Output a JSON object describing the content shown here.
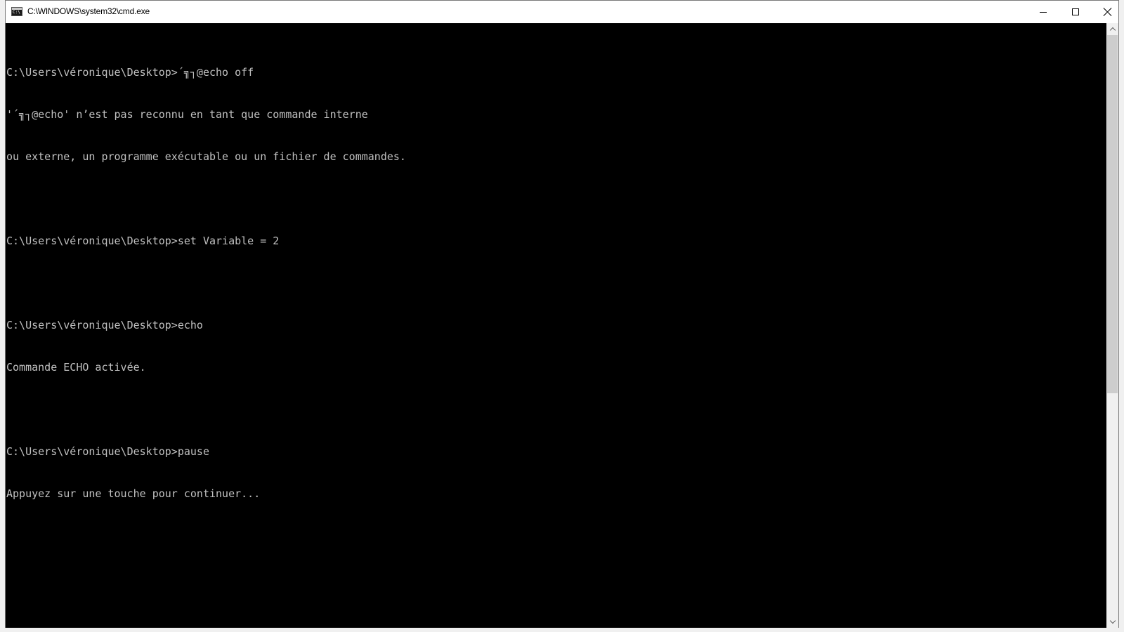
{
  "window": {
    "title": "C:\\WINDOWS\\system32\\cmd.exe",
    "icon": "cmd-icon",
    "controls": {
      "minimize_icon": "minimize-icon",
      "maximize_icon": "maximize-icon",
      "close_icon": "close-icon"
    }
  },
  "console": {
    "background": "#000000",
    "foreground": "#c0c0c0",
    "lines": [
      "C:\\Users\\véronique\\Desktop>´╗┐@echo off",
      "'´╗┐@echo' n’est pas reconnu en tant que commande interne",
      "ou externe, un programme exécutable ou un fichier de commandes.",
      "",
      "C:\\Users\\véronique\\Desktop>set Variable = 2",
      "",
      "C:\\Users\\véronique\\Desktop>echo",
      "Commande ECHO activée.",
      "",
      "C:\\Users\\véronique\\Desktop>pause",
      "Appuyez sur une touche pour continuer..."
    ]
  },
  "scrollbar": {
    "up_icon": "chevron-up-icon",
    "down_icon": "chevron-down-icon"
  }
}
